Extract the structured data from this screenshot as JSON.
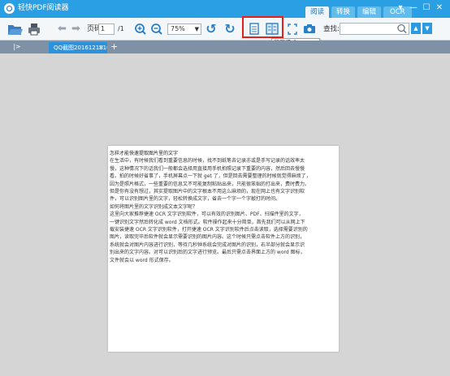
{
  "app": {
    "title": "轻快PDF阅读器",
    "mode_tabs": [
      {
        "label": "阅读",
        "active": true
      },
      {
        "label": "转换",
        "active": false
      },
      {
        "label": "编辑",
        "active": false
      },
      {
        "label": "OCR",
        "active": false
      }
    ],
    "window_controls": [
      "▾",
      "—",
      "☐",
      "✕"
    ]
  },
  "toolbar": {
    "page_label": "页码:",
    "page_value": "1",
    "page_separator": "/1",
    "zoom_value": "75%",
    "search_label": "查找:",
    "search_value": "",
    "tooltip": "双页模式(Ctrl+7)"
  },
  "tabs": {
    "sidebar_toggle": "|>",
    "document_tab": "QQ截图20161219161235...",
    "close": "×",
    "add": "+"
  },
  "document": {
    "lines": [
      "怎样才能快速提取图片里的文字",
      "在生活中，有时候我们看到重要信息的时候，找不到纸笔去记录亦或是手写记录的话效率太",
      "慢，这种情况下的话我们一般都会选择用直接用手机拍照记录下重要的内容，然后回去慢慢",
      "看。拍的时候好省事了，手机屏幕点一下就 get 了，但是回去需要整理的时候就觉得麻烦了，",
      "因为是照片格式，一些重要的信息又不可能复制粘贴出来，只能很笨拙的打出来，费时费力。",
      "但是你有没有想过，其实提取图片中的文字根本不用这么麻烦的，现在网上也有文字识别软",
      "件，可以识别图片里的文字，轻松转换成文字，省去一个字一个字敲打的时间。",
      "如何将图片里的文字识别成文本文字呢？",
      "这里向大家推荐捷速 OCR 文字识别软件，可以有效的识别图片、PDF、扫描件里的文字，",
      "一键识别文字然后转化成 word 文档形式。软件操作起来十分简单，首先我们可以从网上下",
      "载安装捷速 OCR 文字识别软件，打开捷速 OCR 文字识别软件后点击读取，选择需要识别的",
      "图片，读取完毕后软件就会显示需要识别的图片内容。这个时候只需点击软件上方的识别，",
      "系统就会对图片内容进行识别，等待几秒钟系统会完成对图片的识别，右半部分就会显示识",
      "别出来的文字内容。对可以识别后的文字进行预览。最后只需点击界面上方的 word 图标，",
      "文件就会以 word 形式保存。"
    ]
  },
  "colors": {
    "titlebar": "#2b9fe3",
    "tabbar": "#7f91a4",
    "workspace": "#d5d5d5",
    "highlight": "#e3201b",
    "accent": "#2c92dc"
  }
}
